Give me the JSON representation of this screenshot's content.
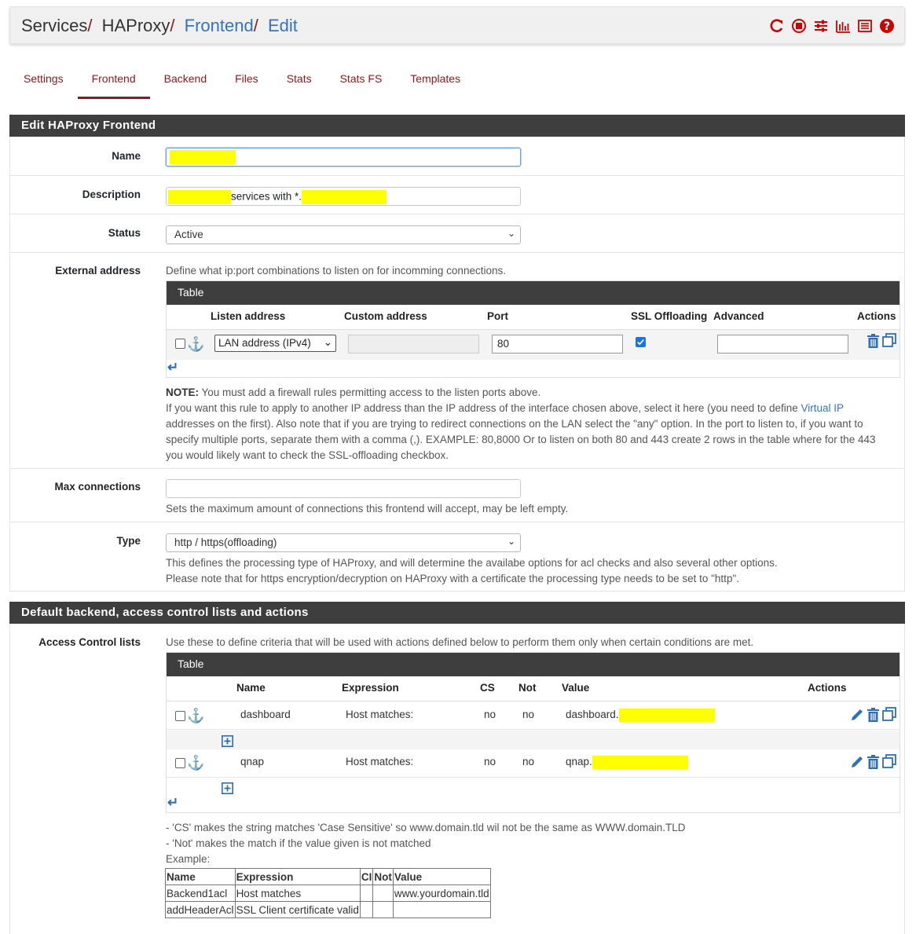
{
  "breadcrumb": {
    "services": "Services",
    "haproxy": "HAProxy",
    "frontend": "Frontend",
    "edit": "Edit",
    "sep": "/"
  },
  "tabs": [
    "Settings",
    "Frontend",
    "Backend",
    "Files",
    "Stats",
    "Stats FS",
    "Templates"
  ],
  "section1": {
    "title": "Edit HAProxy Frontend",
    "name_label": "Name",
    "desc_label": "Description",
    "desc_text_mid": "services with *.",
    "status_label": "Status",
    "status_value": "Active",
    "ext_label": "External address",
    "ext_help": "Define what ip:port combinations to listen on for incomming connections.",
    "ext_table": {
      "title": "Table",
      "headers": [
        "Listen address",
        "Custom address",
        "Port",
        "SSL Offloading",
        "Advanced",
        "Actions"
      ],
      "row": {
        "listen": "LAN address (IPv4)",
        "custom": "",
        "port": "80",
        "ssl": true,
        "advanced": ""
      }
    },
    "note_bold": "NOTE:",
    "note_text": " You must add a firewall rules permitting access to the listen ports above.",
    "note_line2a": "If you want this rule to apply to another IP address than the IP address of the interface chosen above, select it here (you need to define ",
    "note_line2_link": "Virtual IP",
    "note_line3": "addresses on the first). Also note that if you are trying to redirect connections on the LAN select the \"any\" option. In the port to listen to, if you want to",
    "note_line4": "specify multiple ports, separate them with a comma (,). EXAMPLE: 80,8000 Or to listen on both 80 and 443 create 2 rows in the table where for the 443",
    "note_line5": "you would likely want to check the SSL-offloading checkbox.",
    "maxconn_label": "Max connections",
    "maxconn_help": "Sets the maximum amount of connections this frontend will accept, may be left empty.",
    "type_label": "Type",
    "type_value": "http / https(offloading)",
    "type_help1": "This defines the processing type of HAProxy, and will determine the availabe options for acl checks and also several other options.",
    "type_help2": "Please note that for https encryption/decryption on HAProxy with a certificate the processing type needs to be set to \"http\"."
  },
  "section2": {
    "title": "Default backend, access control lists and actions",
    "acl_label": "Access Control lists",
    "acl_help": "Use these to define criteria that will be used with actions defined below to perform them only when certain conditions are met.",
    "acl_table": {
      "title": "Table",
      "headers": [
        "Name",
        "Expression",
        "CS",
        "Not",
        "Value",
        "Actions"
      ],
      "rows": [
        {
          "name": "dashboard",
          "expression": "Host matches:",
          "cs": "no",
          "not": "no",
          "value": "dashboard."
        },
        {
          "name": "qnap",
          "expression": "Host matches:",
          "cs": "no",
          "not": "no",
          "value": "qnap."
        }
      ]
    },
    "hint1": "- 'CS' makes the string matches 'Case Sensitive' so www.domain.tld wil not be the same as WWW.domain.TLD",
    "hint2": "- 'Not' makes the match if the value given is not matched",
    "example_label": "Example:",
    "example_table": {
      "headers": [
        "Name",
        "Expression",
        "CI",
        "Not",
        "Value"
      ],
      "rows": [
        [
          "Backend1acl",
          "Host matches",
          "",
          "",
          "www.yourdomain.tld"
        ],
        [
          "addHeaderAcl",
          "SSL Client certificate valid",
          "",
          "",
          ""
        ]
      ]
    }
  },
  "colors": {
    "accent": "#8b1a1a",
    "link": "#3273c5",
    "header_bg": "#3e3e3e",
    "highlight": "#ffff00",
    "icon_blue": "#2f6fb3"
  },
  "icons": [
    "restart-icon",
    "stop-icon",
    "sliders-icon",
    "bar-chart-icon",
    "list-icon",
    "help-icon",
    "anchor-icon",
    "trash-icon",
    "copy-icon",
    "edit-icon",
    "add-icon",
    "move-down-icon"
  ]
}
